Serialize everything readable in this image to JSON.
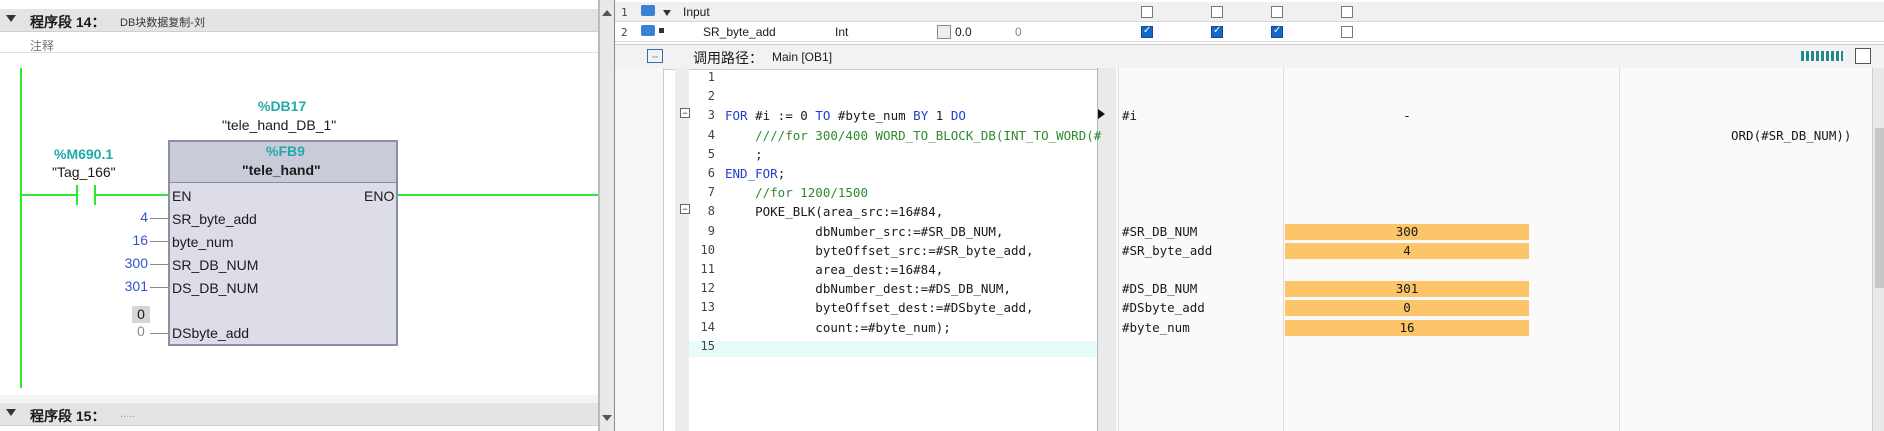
{
  "left": {
    "seg14": {
      "label": "程序段 14：",
      "title": "DB块数据复制-刘"
    },
    "comment": "注释",
    "db": {
      "addr": "%DB17",
      "name": "\"tele_hand_DB_1\""
    },
    "contact": {
      "addr": "%M690.1",
      "name": "\"Tag_166\""
    },
    "fb": {
      "addr": "%FB9",
      "name": "\"tele_hand\"",
      "en": "EN",
      "eno": "ENO"
    },
    "inputs": [
      {
        "label": "SR_byte_add",
        "value": "4"
      },
      {
        "label": "byte_num",
        "value": "16"
      },
      {
        "label": "SR_DB_NUM",
        "value": "300"
      },
      {
        "label": "DS_DB_NUM",
        "value": "301"
      }
    ],
    "output": {
      "label": "DSbyte_add",
      "monitor": "0",
      "value": "0"
    },
    "seg15": {
      "label": "程序段 15：",
      "title": "....."
    }
  },
  "right": {
    "iface": {
      "rows": [
        {
          "num": "1",
          "name": "Input",
          "type": "",
          "default": "",
          "monitor": ""
        },
        {
          "num": "2",
          "name": "SR_byte_add",
          "type": "Int",
          "default": "0.0",
          "monitor": "0"
        }
      ]
    },
    "callpath": {
      "label": "调用路径：",
      "value": "Main [OB1]"
    },
    "code_lines": [
      {
        "n": "1",
        "t": ""
      },
      {
        "n": "2",
        "t": ""
      },
      {
        "n": "3",
        "t": "FOR #i := 0 TO #byte_num BY 1 DO"
      },
      {
        "n": "4",
        "t": "    ////for 300/400 WORD_TO_BLOCK_DB(INT_TO_WORD(#"
      },
      {
        "n": "5",
        "t": "    ;"
      },
      {
        "n": "6",
        "t": "END_FOR;"
      },
      {
        "n": "7",
        "t": "    //for 1200/1500"
      },
      {
        "n": "8",
        "t": "    POKE_BLK(area_src:=16#84,"
      },
      {
        "n": "9",
        "t": "            dbNumber_src:=#SR_DB_NUM,"
      },
      {
        "n": "10",
        "t": "            byteOffset_src:=#SR_byte_add,"
      },
      {
        "n": "11",
        "t": "            area_dest:=16#84,"
      },
      {
        "n": "12",
        "t": "            dbNumber_dest:=#DS_DB_NUM,"
      },
      {
        "n": "13",
        "t": "            byteOffset_dest:=#DSbyte_add,"
      },
      {
        "n": "14",
        "t": "            count:=#byte_num);"
      },
      {
        "n": "15",
        "t": ""
      }
    ],
    "monitor": [
      {
        "line": "3",
        "name": "#i",
        "value": "-"
      },
      {
        "line": "4",
        "name": "",
        "value": "",
        "tail": "ORD(#SR_DB_NUM))"
      },
      {
        "line": "9",
        "name": "#SR_DB_NUM",
        "value": "300"
      },
      {
        "line": "10",
        "name": "#SR_byte_add",
        "value": "4"
      },
      {
        "line": "12",
        "name": "#DS_DB_NUM",
        "value": "301"
      },
      {
        "line": "13",
        "name": "#DSbyte_add",
        "value": "0"
      },
      {
        "line": "14",
        "name": "#byte_num",
        "value": "16"
      }
    ]
  }
}
